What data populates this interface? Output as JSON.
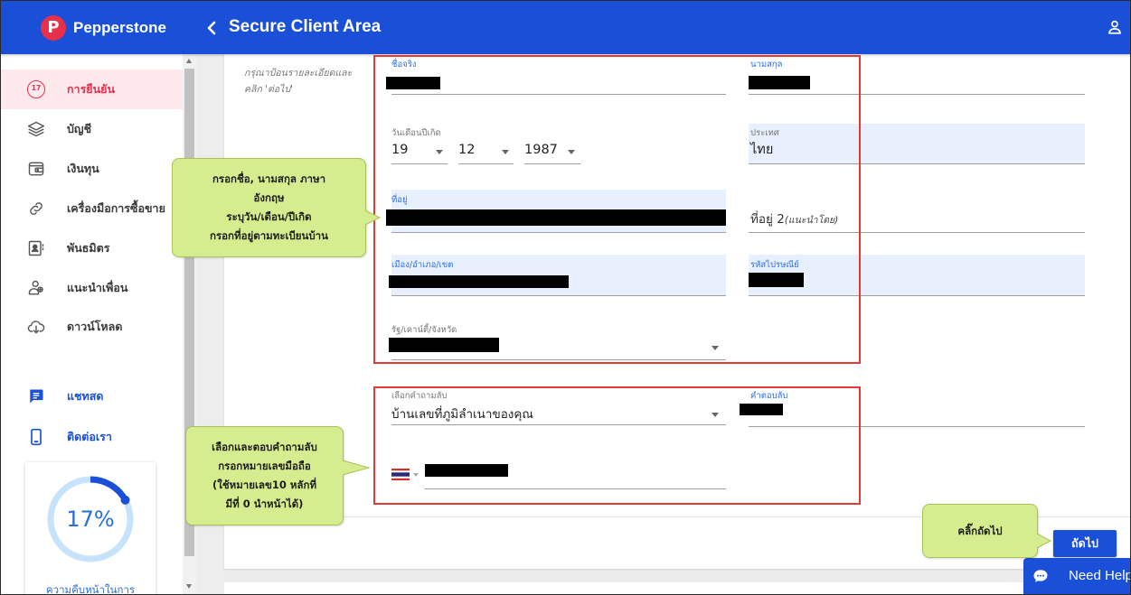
{
  "colors": {
    "brand_blue": "#1a50d8",
    "active_red": "#e5304d",
    "active_bg": "#fde9ec",
    "field_highlight": "#e8f0fe",
    "annotation_outline": "#e53935",
    "callout_green": "#d5ec8f"
  },
  "header": {
    "logo_letter": "P",
    "brand": "Pepperstone",
    "back_icon": "chevron-left-icon",
    "title": "Secure Client Area",
    "user_icon": "user-icon"
  },
  "sidebar": {
    "items": [
      {
        "label": "การยืนยัน",
        "icon": "verification-progress-icon",
        "badge": "17",
        "active": true
      },
      {
        "label": "บัญชี",
        "icon": "layers-icon"
      },
      {
        "label": "เงินทุน",
        "icon": "wallet-icon"
      },
      {
        "label": "เครื่องมือการซื้อขาย",
        "icon": "trading-tools-icon"
      },
      {
        "label": "พันธมิตร",
        "icon": "contact-card-icon"
      },
      {
        "label": "แนะนำเพื่อน",
        "icon": "refer-friend-icon"
      },
      {
        "label": "ดาวน์โหลด",
        "icon": "cloud-download-icon"
      }
    ],
    "support": [
      {
        "label": "แชทสด",
        "icon": "chat-icon"
      },
      {
        "label": "ติดต่อเรา",
        "icon": "mobile-phone-icon"
      }
    ],
    "progress": {
      "value": 17,
      "label": "17%",
      "caption": "ความคืบหน้าในการ"
    }
  },
  "form": {
    "instructions": [
      "กรุณาป้อนรายละเอียดและ",
      "คลิก 'ต่อไป'"
    ],
    "first_name": {
      "label": "ชื่อจริง",
      "redacted": true
    },
    "last_name": {
      "label": "นามสกุล",
      "redacted": true
    },
    "dob": {
      "label": "วันเดือนปีเกิด",
      "day": "19",
      "month": "12",
      "year": "1987"
    },
    "country": {
      "label": "ประเทศ",
      "value": "ไทย"
    },
    "address1": {
      "label": "ที่อยู่",
      "redacted": true
    },
    "address2": {
      "placeholder": "ที่อยู่ 2",
      "placeholder_hint": "(แนะนำโดย)"
    },
    "city": {
      "label": "เมือง/อำเภอ/เขต",
      "redacted": true
    },
    "postcode": {
      "label": "รหัสไปรษณีย์",
      "redacted": true
    },
    "state": {
      "label": "รัฐ/เคาน์ตี้/จังหวัด",
      "redacted": true
    },
    "secret_question": {
      "label": "เลือกคำถามลับ",
      "value": "บ้านเลขที่ภูมิลำเนาของคุณ"
    },
    "secret_answer": {
      "label": "คำตอบลับ",
      "redacted": true
    },
    "phone": {
      "country_flag": "thailand-flag-icon",
      "redacted": true
    },
    "next_button": "ถัดไป"
  },
  "chat_widget": {
    "label": "Need Help",
    "icon": "chat-bubble-icon"
  },
  "annotations": {
    "callout_personal": [
      "กรอกชื่อ, นามสกุล ภาษา",
      "อังกฤษ",
      "ระบุวัน/เดือน/ปีเกิด",
      "กรอกที่อยู่ตามทะเบียนบ้าน"
    ],
    "callout_security": [
      "เลือกและตอบคำถามลับ",
      "กรอกหมายเลขมือถือ",
      "(ใช้หมายเลข10 หลักที่",
      "มีที่ 0 นำหน้าได้)"
    ],
    "callout_next": [
      "คลิ๊กถัดไป"
    ]
  }
}
